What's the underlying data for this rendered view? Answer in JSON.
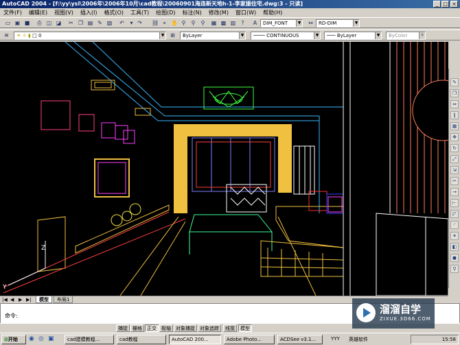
{
  "window": {
    "title": "AutoCAD 2004 - [f:\\yy\\ysl\\2006年\\2006年10月\\cad教程\\20060901海连新天地h-1-李家振住宅.dwg:3 - 只读]"
  },
  "menu": [
    "文件(F)",
    "编辑(E)",
    "视图(V)",
    "插入(I)",
    "格式(O)",
    "工具(T)",
    "绘图(D)",
    "标注(N)",
    "修改(M)",
    "窗口(W)",
    "帮助(H)"
  ],
  "toolbar": {
    "text_style": "DIM_FONT",
    "dim_style": "RD-DIM",
    "layer": "0",
    "color": "ByLayer",
    "linetype": "CONTINUOUS",
    "lineweight": "ByLayer",
    "plotstyle": "ByColor"
  },
  "layout_tabs": [
    "模型",
    "布局1"
  ],
  "command": {
    "prompt": "命令:"
  },
  "status_buttons": [
    {
      "label": "捕捉",
      "on": false
    },
    {
      "label": "栅格",
      "on": false
    },
    {
      "label": "正交",
      "on": true
    },
    {
      "label": "极轴",
      "on": false
    },
    {
      "label": "对象捕捉",
      "on": false
    },
    {
      "label": "对象追踪",
      "on": false
    },
    {
      "label": "线宽",
      "on": false
    },
    {
      "label": "模型",
      "on": true
    }
  ],
  "taskbar": {
    "start": "开始",
    "tasks": [
      "cad建模教程...",
      "cad教程",
      "AutoCAD 200...",
      "Adobe Photo...",
      "ACDSee v3.1...",
      "YYY"
    ],
    "tray_app": "英雄软件",
    "clock": "15:58"
  },
  "watermark": {
    "name": "溜溜自学",
    "url": "ZIXUE.3D66.COM"
  },
  "ucs": {
    "z": "Z",
    "y": "Y"
  },
  "colors": {
    "titlebar": "#0a246a",
    "viewport": "#000000",
    "accent_yellow": "#f0c040",
    "lime": "#40ff40"
  }
}
